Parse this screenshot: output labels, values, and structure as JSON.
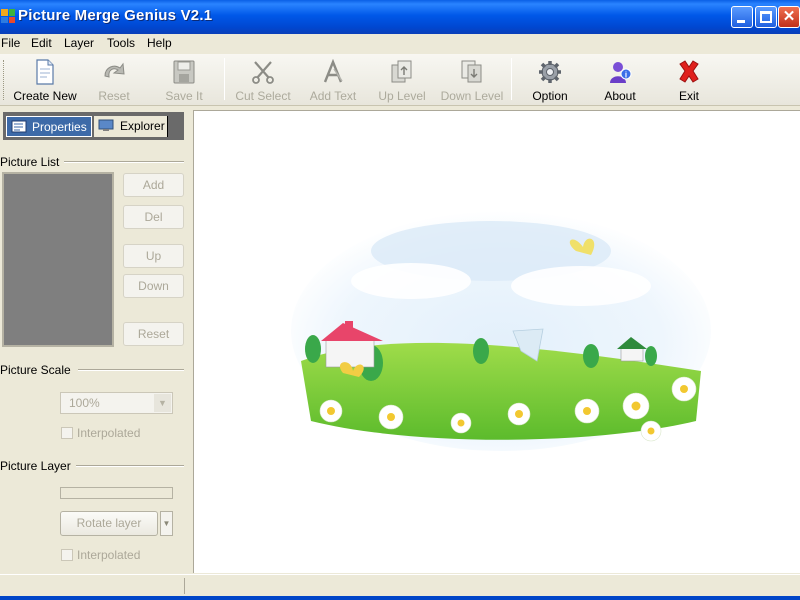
{
  "window": {
    "title": "Picture Merge Genius V2.1",
    "titlebar_color": "#0055e5"
  },
  "menu": {
    "items": [
      "File",
      "Edit",
      "Layer",
      "Tools",
      "Help"
    ]
  },
  "toolbar": {
    "buttons": [
      {
        "label": "Create New",
        "icon": "new-document-icon",
        "enabled": true
      },
      {
        "label": "Reset",
        "icon": "reset-icon",
        "enabled": false
      },
      {
        "label": "Save It",
        "icon": "save-icon",
        "enabled": false
      },
      {
        "label": "Cut Select",
        "icon": "scissors-icon",
        "enabled": false
      },
      {
        "label": "Add Text",
        "icon": "text-icon",
        "enabled": false
      },
      {
        "label": "Up Level",
        "icon": "up-level-icon",
        "enabled": false
      },
      {
        "label": "Down Level",
        "icon": "down-level-icon",
        "enabled": false
      },
      {
        "label": "Option",
        "icon": "gear-icon",
        "enabled": true
      },
      {
        "label": "About",
        "icon": "user-info-icon",
        "enabled": true
      },
      {
        "label": "Exit",
        "icon": "red-x-icon",
        "enabled": true
      }
    ]
  },
  "left_panel": {
    "tabs": [
      {
        "label": "Properties",
        "active": true
      },
      {
        "label": "Explorer",
        "active": false
      }
    ],
    "picture_list": {
      "title": "Picture List",
      "buttons": [
        "Add",
        "Del",
        "Up",
        "Down",
        "Reset"
      ]
    },
    "picture_scale": {
      "title": "Picture Scale",
      "value": "100%",
      "interpolated_label": "Interpolated",
      "interpolated_checked": false
    },
    "picture_layer": {
      "title": "Picture Layer",
      "rotate_label": "Rotate layer",
      "interpolated_label": "Interpolated",
      "interpolated_checked": false
    }
  },
  "canvas": {
    "background": "#ffffff",
    "image_description_icon": "landscape-image"
  }
}
